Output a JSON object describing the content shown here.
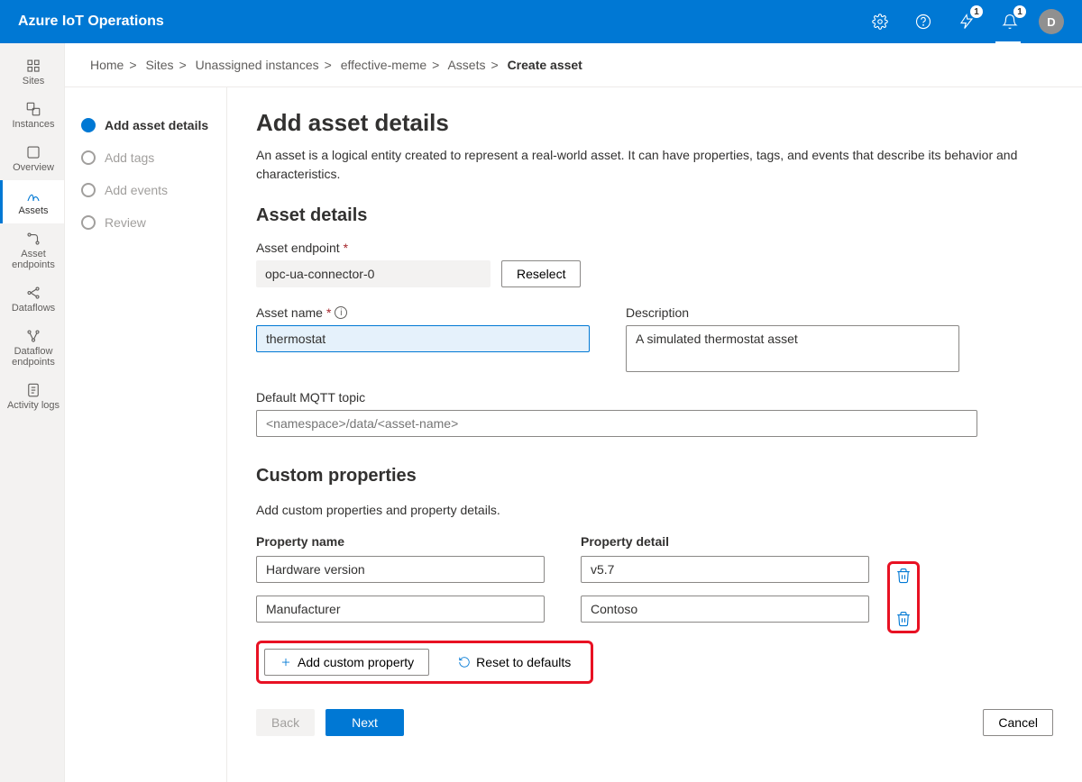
{
  "header": {
    "title": "Azure IoT Operations",
    "badge1": "1",
    "badge2": "1",
    "avatar": "D"
  },
  "nav": {
    "items": [
      {
        "label": "Sites"
      },
      {
        "label": "Instances"
      },
      {
        "label": "Overview"
      },
      {
        "label": "Assets"
      },
      {
        "label": "Asset endpoints"
      },
      {
        "label": "Dataflows"
      },
      {
        "label": "Dataflow endpoints"
      },
      {
        "label": "Activity logs"
      }
    ]
  },
  "breadcrumb": {
    "items": [
      "Home",
      "Sites",
      "Unassigned instances",
      "effective-meme",
      "Assets"
    ],
    "current": "Create asset"
  },
  "steps": {
    "items": [
      {
        "label": "Add asset details"
      },
      {
        "label": "Add tags"
      },
      {
        "label": "Add events"
      },
      {
        "label": "Review"
      }
    ]
  },
  "page": {
    "title": "Add asset details",
    "lead": "An asset is a logical entity created to represent a real-world asset. It can have properties, tags, and events that describe its behavior and characteristics.",
    "section1_title": "Asset details",
    "endpoint_label": "Asset endpoint",
    "endpoint_value": "opc-ua-connector-0",
    "reselect": "Reselect",
    "name_label": "Asset name",
    "name_value": "thermostat",
    "desc_label": "Description",
    "desc_value": "A simulated thermostat asset",
    "mqtt_label": "Default MQTT topic",
    "mqtt_placeholder": "<namespace>/data/<asset-name>",
    "section2_title": "Custom properties",
    "section2_lead": "Add custom properties and property details.",
    "prop_name_header": "Property name",
    "prop_detail_header": "Property detail",
    "props": [
      {
        "name": "Hardware version",
        "detail": "v5.7"
      },
      {
        "name": "Manufacturer",
        "detail": "Contoso"
      }
    ],
    "add_custom": "Add custom property",
    "reset_defaults": "Reset to defaults",
    "back": "Back",
    "next": "Next",
    "cancel": "Cancel"
  }
}
